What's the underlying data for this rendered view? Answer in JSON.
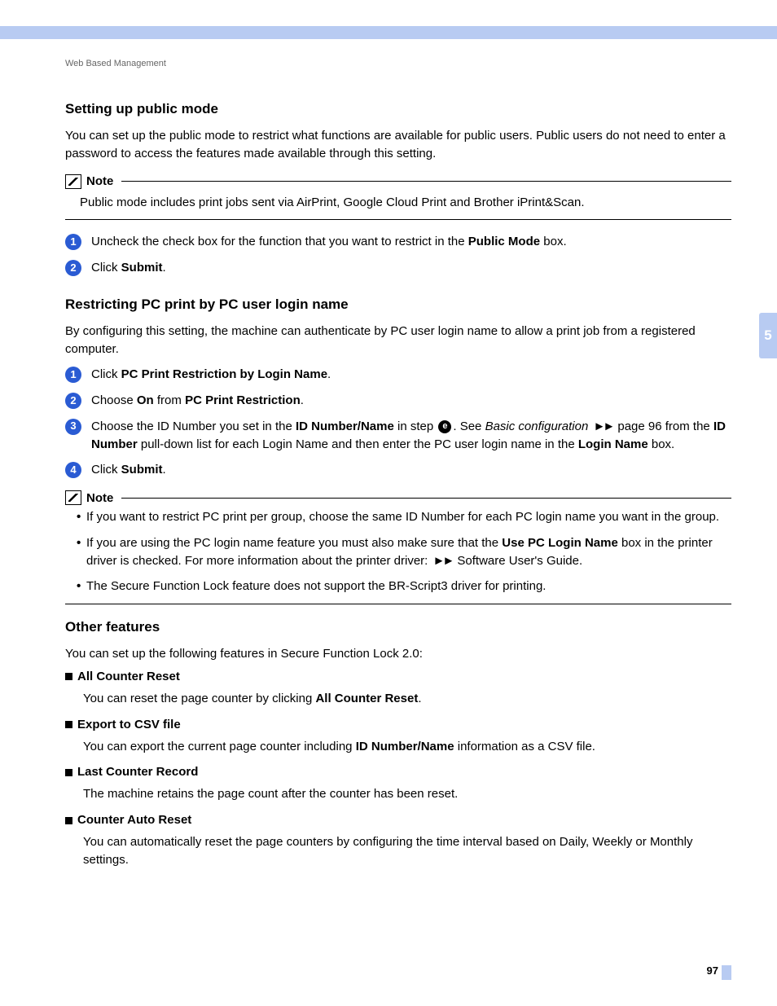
{
  "running_header": "Web Based Management",
  "side_tab": "5",
  "page_number": "97",
  "s1": {
    "heading": "Setting up public mode",
    "intro": "You can set up the public mode to restrict what functions are available for public users. Public users do not need to enter a password to access the features made available through this setting.",
    "note_label": "Note",
    "note_body": "Public mode includes print jobs sent via AirPrint, Google Cloud Print and Brother iPrint&Scan.",
    "steps": [
      {
        "n": "1",
        "pre": "Uncheck the check box for the function that you want to restrict in the ",
        "bold1": "Public Mode",
        "post": " box."
      },
      {
        "n": "2",
        "pre": "Click ",
        "bold1": "Submit",
        "post": "."
      }
    ]
  },
  "s2": {
    "heading": "Restricting PC print by PC user login name",
    "intro": "By configuring this setting, the machine can authenticate by PC user login name to allow a print job from a registered computer.",
    "steps": {
      "a_n": "1",
      "a_pre": "Click ",
      "a_b": "PC Print Restriction by Login Name",
      "a_post": ".",
      "b_n": "2",
      "b_pre": "Choose ",
      "b_b1": "On",
      "b_mid": " from ",
      "b_b2": "PC Print Restriction",
      "b_post": ".",
      "c_n": "3",
      "c_t1": "Choose the ID Number you set in the ",
      "c_b1": "ID Number/Name",
      "c_t2": " in step ",
      "c_inline": "e",
      "c_t3": ". See ",
      "c_i": "Basic configuration",
      "c_t4": " page 96 from the ",
      "c_b2": "ID Number",
      "c_t5": " pull-down list for each Login Name and then enter the PC user login name in the ",
      "c_b3": "Login Name",
      "c_t6": " box.",
      "d_n": "4",
      "d_pre": "Click ",
      "d_b": "Submit",
      "d_post": "."
    },
    "note_label": "Note",
    "note_items": {
      "i1": "If you want to restrict PC print per group, choose the same ID Number for each PC login name you want in the group.",
      "i2_a": "If you are using the PC login name feature you must also make sure that the ",
      "i2_b": "Use PC Login Name",
      "i2_c": " box in the printer driver is checked. For more information about the printer driver: ",
      "i2_d": " Software User's Guide.",
      "i3": "The Secure Function Lock feature does not support the BR-Script3 driver for printing."
    }
  },
  "s3": {
    "heading": "Other features",
    "intro": "You can set up the following features in Secure Function Lock 2.0:",
    "features": {
      "f1t": "All Counter Reset",
      "f1d_a": "You can reset the page counter by clicking ",
      "f1d_b": "All Counter Reset",
      "f1d_c": ".",
      "f2t": "Export to CSV file",
      "f2d_a": "You can export the current page counter including ",
      "f2d_b": "ID Number/Name",
      "f2d_c": " information as a CSV file.",
      "f3t": "Last Counter Record",
      "f3d": "The machine retains the page count after the counter has been reset.",
      "f4t": "Counter Auto Reset",
      "f4d": "You can automatically reset the page counters by configuring the time interval based on Daily, Weekly or Monthly settings."
    }
  }
}
